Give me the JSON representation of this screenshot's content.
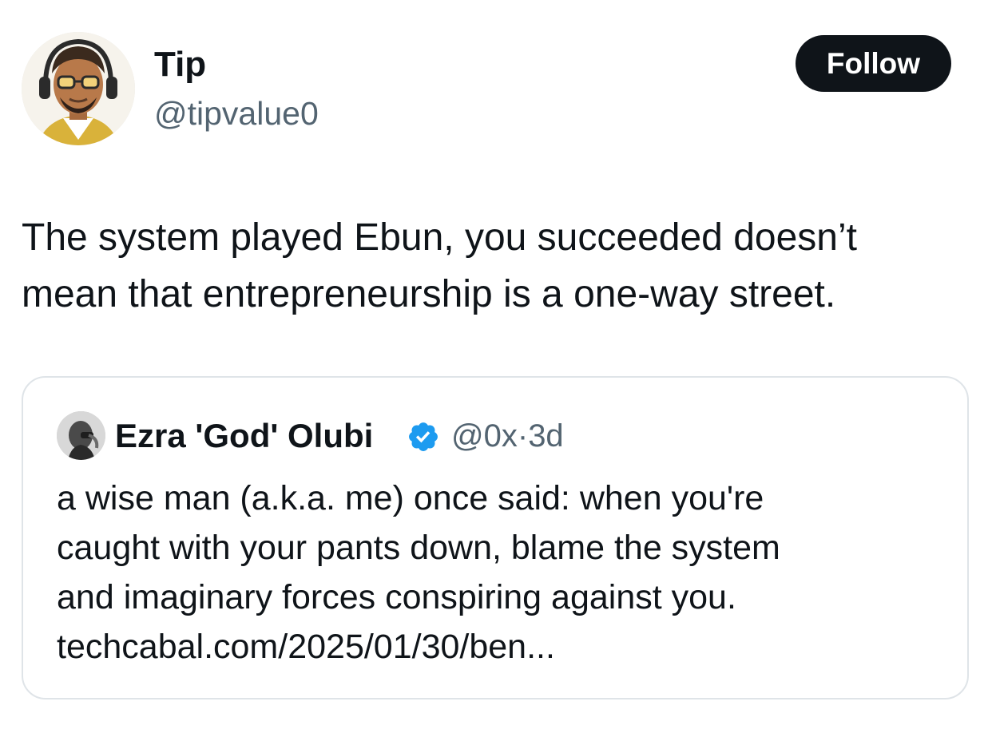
{
  "author": {
    "display_name": "Tip",
    "handle": "@tipvalue0",
    "avatar_icon": "illustrated-avatar-with-headphones"
  },
  "follow_button": {
    "label": "Follow"
  },
  "tweet": {
    "text_lines": [
      "The system played Ebun, you succeeded doesn’t",
      "mean that entrepreneurship is a one-way street."
    ]
  },
  "quoted_tweet": {
    "display_name": "Ezra 'God' Olubi",
    "verified_icon": "verified-badge-icon",
    "handle": "@0x",
    "separator": "·",
    "time": "3d",
    "text_lines": [
      "a wise man (a.k.a. me) once said: when you're",
      "caught with your pants down, blame the system",
      "and imaginary forces conspiring against you.",
      "techcabal.com/2025/01/30/ben..."
    ]
  },
  "colors": {
    "text_primary": "#0f1419",
    "text_secondary": "#536471",
    "follow_bg": "#0f1419",
    "verified": "#1d9bf0",
    "border": "#dfe4e8"
  }
}
